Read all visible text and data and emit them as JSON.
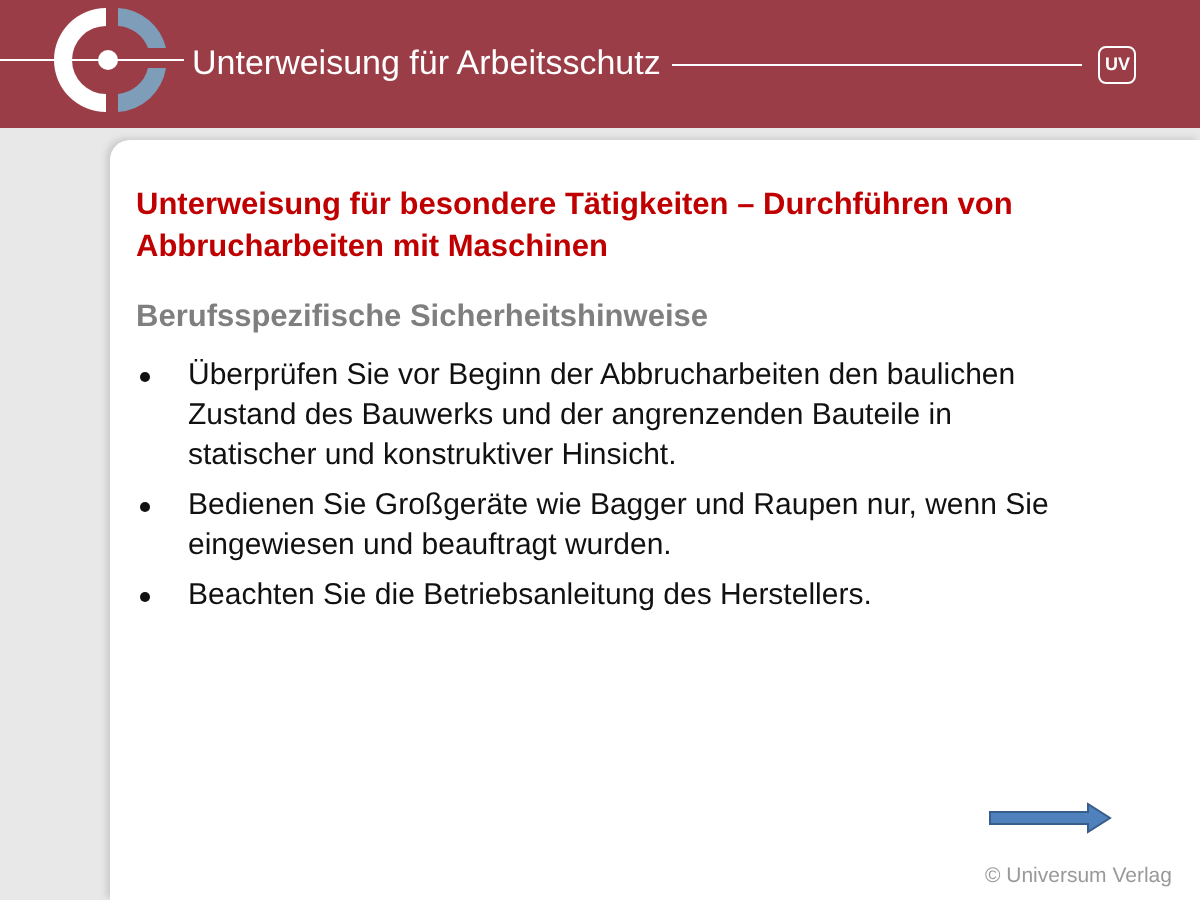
{
  "header": {
    "title": "Unterweisung für Arbeitsschutz",
    "badge": "UV"
  },
  "slide": {
    "title": "Unterweisung für besondere Tätigkeiten – Durchführen von Abbrucharbeiten mit Maschinen",
    "subtitle": "Berufsspezifische Sicherheitshinweise",
    "bullets": [
      "Überprüfen Sie vor Beginn der Abbrucharbeiten den baulichen Zustand des Bauwerks und der angrenzenden Bauteile in statischer und konstruktiver Hinsicht.",
      "Bedienen Sie Großgeräte wie Bagger und Raupen nur, wenn Sie eingewiesen und beauftragt wurden.",
      "Beachten Sie die Betriebsanleitung des Herstellers."
    ]
  },
  "footer": {
    "copyright": "© Universum Verlag"
  }
}
